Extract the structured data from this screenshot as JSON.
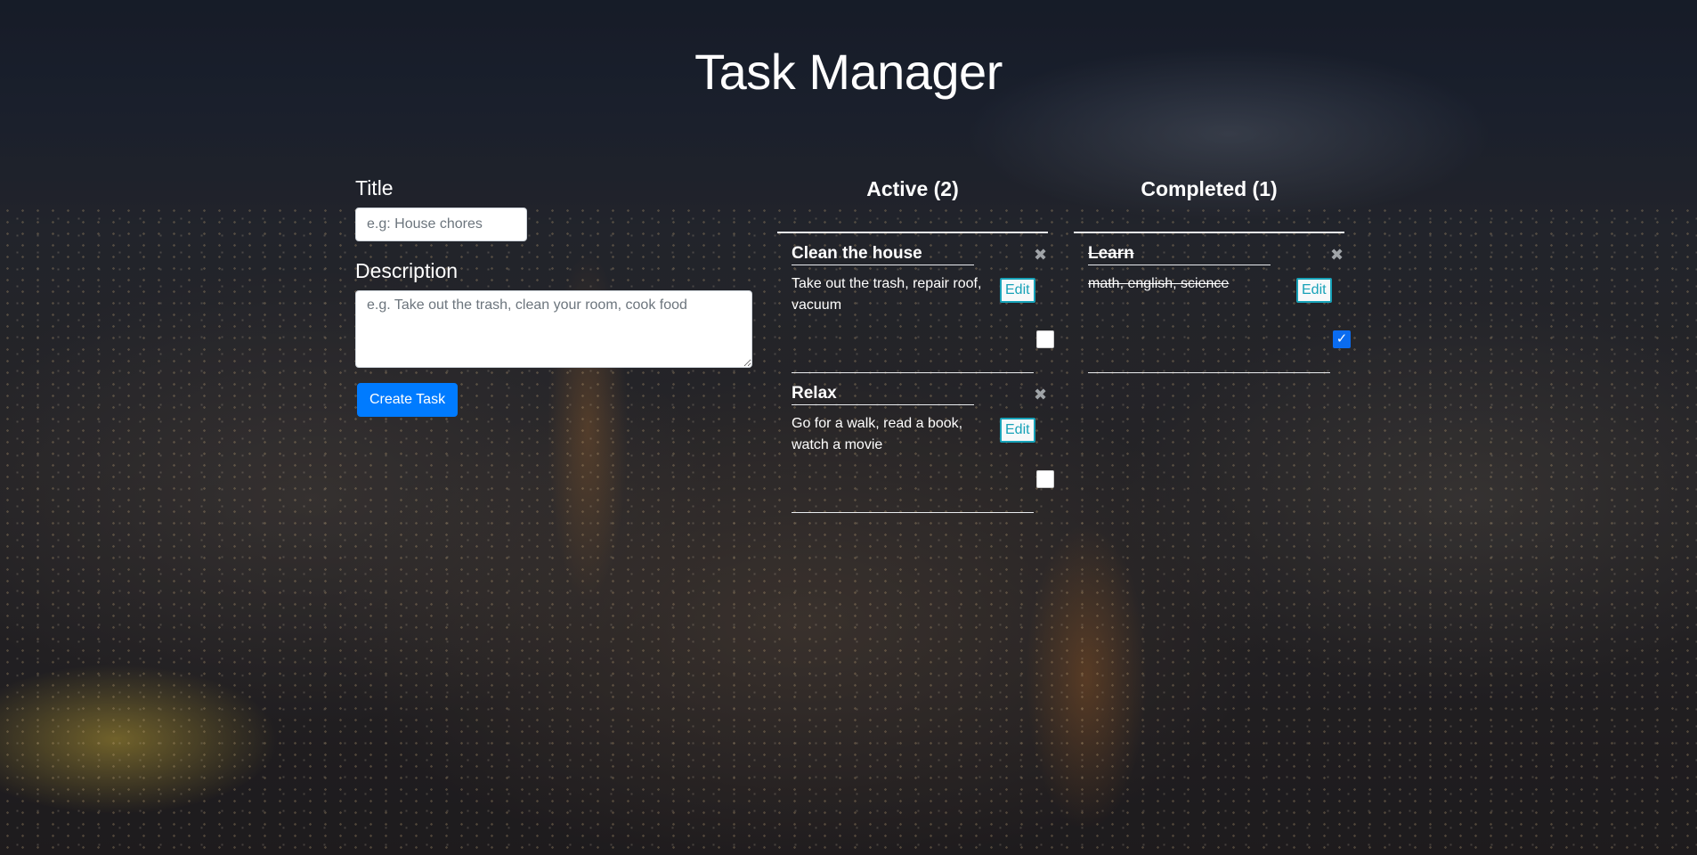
{
  "page": {
    "title": "Task Manager"
  },
  "form": {
    "title_label": "Title",
    "title_placeholder": "e.g: House chores",
    "description_label": "Description",
    "description_placeholder": "e.g. Take out the trash, clean your room, cook food",
    "create_button_label": "Create Task"
  },
  "columns": {
    "active": {
      "header": "Active (2)",
      "tasks": [
        {
          "title": "Clean the house",
          "description": "Take out the trash, repair roof, vacuum",
          "edit_label": "Edit",
          "close_icon": "times-icon",
          "completed": false
        },
        {
          "title": "Relax",
          "description": "Go for a walk, read a book, watch a movie",
          "edit_label": "Edit",
          "close_icon": "times-icon",
          "completed": false
        }
      ]
    },
    "completed": {
      "header": "Completed (1)",
      "tasks": [
        {
          "title": "Learn",
          "description": "math, english, science",
          "edit_label": "Edit",
          "close_icon": "times-icon",
          "completed": true
        }
      ]
    }
  },
  "colors": {
    "primary_button": "#007bff",
    "edit_button_border": "#17a2b8",
    "checkbox_checked": "#0a6cf0"
  }
}
